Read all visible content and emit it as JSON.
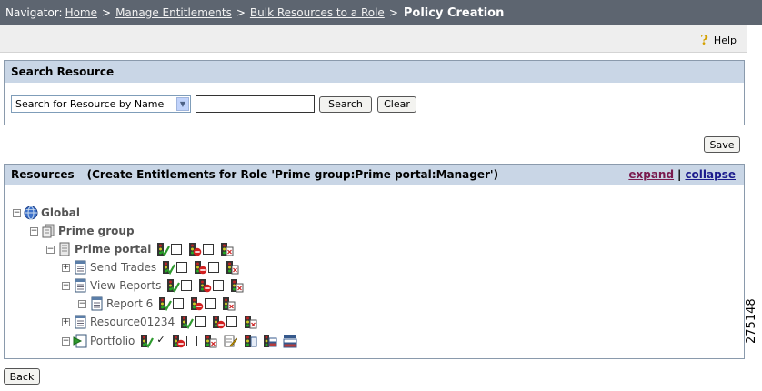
{
  "navigator": {
    "label": "Navigator:",
    "crumbs": [
      "Home",
      "Manage Entitlements",
      "Bulk Resources to a Role"
    ],
    "separator": ">",
    "current": "Policy Creation"
  },
  "help": {
    "label": "Help",
    "icon": "question-icon"
  },
  "search": {
    "title": "Search Resource",
    "select_value": "Search for Resource by Name",
    "input_value": "",
    "search_label": "Search",
    "clear_label": "Clear"
  },
  "save_label": "Save",
  "resources": {
    "title": "Resources",
    "subtitle": "(Create Entitlements for Role 'Prime group:Prime portal:Manager')",
    "expand_label": "expand",
    "collapse_label": "collapse",
    "separator": "|",
    "tree": [
      {
        "label": "Global",
        "toggle": "−",
        "icon": "globe-icon"
      },
      {
        "label": "Prime group",
        "toggle": "−",
        "icon": "server-group-icon"
      },
      {
        "label": "Prime portal",
        "toggle": "−",
        "icon": "server-icon"
      },
      {
        "label": "Send Trades",
        "toggle": "+",
        "icon": "document-icon"
      },
      {
        "label": "View Reports",
        "toggle": "−",
        "icon": "document-icon"
      },
      {
        "label": "Report 6",
        "toggle": "−",
        "icon": "document-icon"
      },
      {
        "label": "Resource01234",
        "toggle": "+",
        "icon": "document-icon"
      },
      {
        "label": "Portfolio",
        "toggle": "−",
        "icon": "portlet-icon"
      }
    ]
  },
  "back_label": "Back",
  "figure_number": "275148",
  "colors": {
    "navbar": "#5d6570",
    "panel_header": "#c9d6e6",
    "panel_border": "#8a9aac",
    "allow_green": "#2e9a2e",
    "deny_red": "#d11f1f"
  }
}
